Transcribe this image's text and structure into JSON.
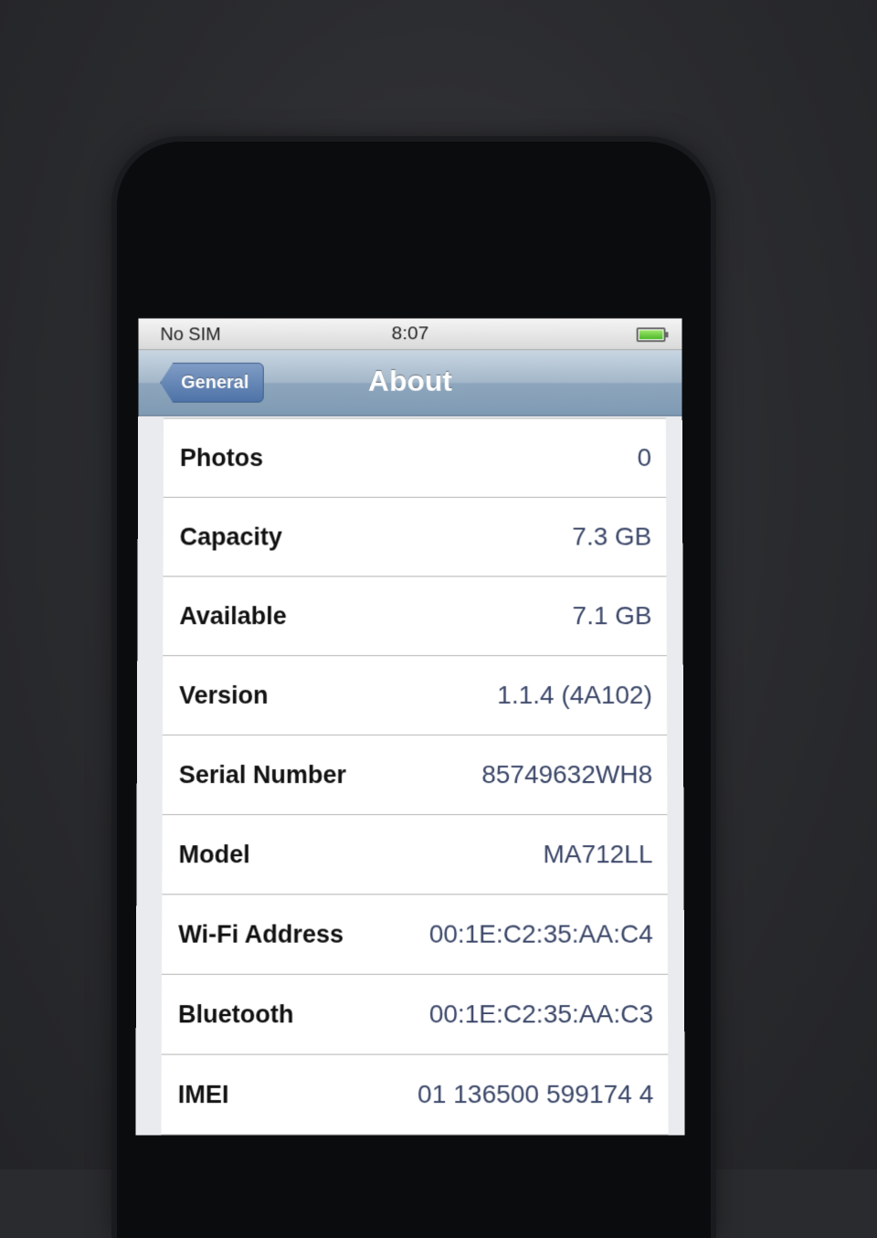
{
  "status_bar": {
    "carrier": "No SIM",
    "time": "8:07",
    "battery_icon": "battery-icon",
    "battery_level": 1.0
  },
  "nav": {
    "back_label": "General",
    "title": "About"
  },
  "rows": [
    {
      "label": "Photos",
      "value": "0"
    },
    {
      "label": "Capacity",
      "value": "7.3 GB"
    },
    {
      "label": "Available",
      "value": "7.1 GB"
    },
    {
      "label": "Version",
      "value": "1.1.4 (4A102)"
    },
    {
      "label": "Serial Number",
      "value": "85749632WH8"
    },
    {
      "label": "Model",
      "value": "MA712LL"
    },
    {
      "label": "Wi-Fi Address",
      "value": "00:1E:C2:35:AA:C4"
    },
    {
      "label": "Bluetooth",
      "value": "00:1E:C2:35:AA:C3"
    },
    {
      "label": "IMEI",
      "value": "01 136500 599174 4"
    }
  ],
  "colors": {
    "nav_bar": "#8da6bd",
    "back_button": "#4e73a8",
    "value_text": "#3a4668",
    "battery_fill": "#4cb82a"
  }
}
